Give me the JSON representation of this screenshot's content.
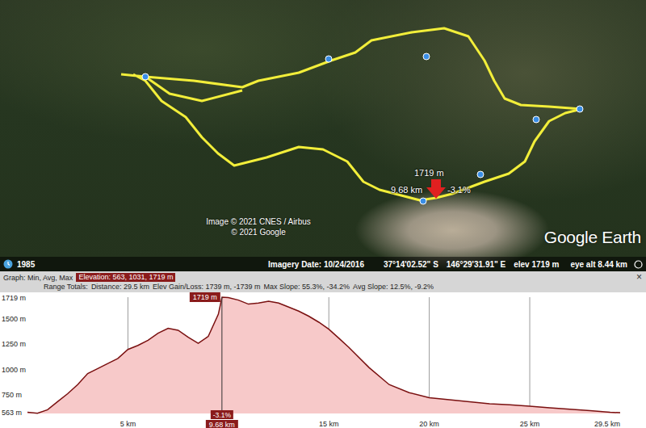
{
  "map": {
    "marker": {
      "elevation": "1719 m",
      "distance": "9.68 km",
      "slope": "-3.1%"
    },
    "attribution": [
      "Image © 2021 CNES / Airbus",
      "© 2021 Google"
    ],
    "logo": "Google Earth"
  },
  "status_bar": {
    "historical": "1985",
    "imagery_date": "Imagery Date: 10/24/2016",
    "latitude": "37°14'02.52\" S",
    "longitude": "146°29'31.91\" E",
    "elevation": "elev 1719 m",
    "eye_alt": "eye alt 8.44 km"
  },
  "profile": {
    "graph_label": "Graph: Min, Avg, Max",
    "elevation_summary": "Elevation: 563, 1031, 1719 m",
    "range_label": "Range Totals:",
    "totals": [
      "Distance: 29.5 km",
      "Elev Gain/Loss: 1739 m, -1739 m",
      "Max Slope: 55.3%, -34.2%",
      "Avg Slope: 12.5%, -9.2%"
    ],
    "close": "×",
    "y_ticks": [
      {
        "value": 1719,
        "label": "1719 m"
      },
      {
        "value": 1500,
        "label": "1500 m"
      },
      {
        "value": 1250,
        "label": "1250 m"
      },
      {
        "value": 1000,
        "label": "1000 m"
      },
      {
        "value": 750,
        "label": "750 m"
      },
      {
        "value": 563,
        "label": "563 m"
      }
    ],
    "x_ticks": [
      {
        "value": 5,
        "label": "5 km"
      },
      {
        "value": 15,
        "label": "15 km"
      },
      {
        "value": 20,
        "label": "20 km"
      },
      {
        "value": 25,
        "label": "25 km"
      },
      {
        "value": 29.5,
        "label": "29.5 km"
      }
    ],
    "grid_km": [
      5,
      10,
      15,
      20,
      25
    ],
    "cursor": {
      "distance": 9.68,
      "elevation_label": "1719 m",
      "distance_label": "9.68 km",
      "slope_label": "-3.1%"
    },
    "series": {
      "name": "Elevation",
      "distances": [
        0,
        0.5,
        1,
        1.5,
        2,
        2.5,
        3,
        3.5,
        4,
        4.5,
        5,
        5.5,
        6,
        6.5,
        7,
        7.5,
        8,
        8.5,
        9,
        9.5,
        9.68,
        10,
        10.5,
        11,
        11.5,
        12,
        12.5,
        13,
        13.5,
        14,
        14.5,
        15,
        15.5,
        16,
        17,
        18,
        19,
        20,
        21,
        22,
        23,
        24,
        25,
        26,
        27,
        28,
        29,
        29.5
      ],
      "elevations": [
        575,
        565,
        600,
        680,
        760,
        850,
        960,
        1010,
        1060,
        1110,
        1200,
        1240,
        1290,
        1360,
        1410,
        1390,
        1320,
        1260,
        1330,
        1550,
        1719,
        1715,
        1690,
        1650,
        1660,
        1680,
        1660,
        1620,
        1580,
        1530,
        1470,
        1400,
        1310,
        1220,
        1020,
        850,
        770,
        720,
        700,
        680,
        660,
        650,
        635,
        620,
        605,
        590,
        575,
        570
      ]
    }
  }
}
